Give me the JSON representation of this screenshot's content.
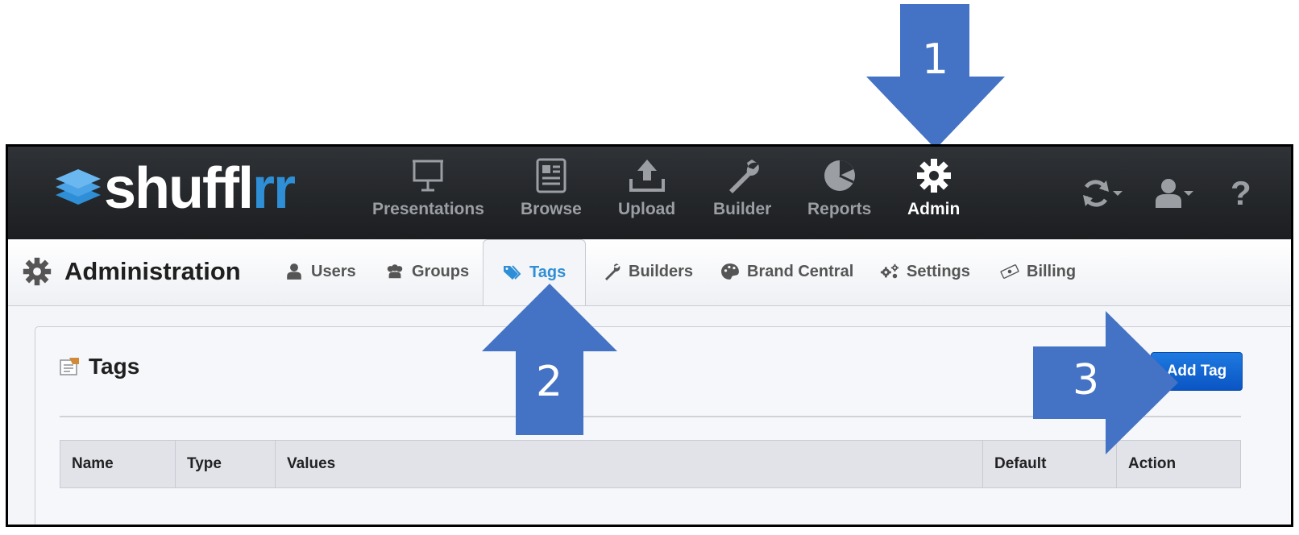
{
  "brand": {
    "logo_main": "shuffl",
    "logo_accent": "rr"
  },
  "topnav": {
    "items": [
      {
        "label": "Presentations",
        "icon": "presentation-board-icon"
      },
      {
        "label": "Browse",
        "icon": "browse-document-icon"
      },
      {
        "label": "Upload",
        "icon": "upload-icon"
      },
      {
        "label": "Builder",
        "icon": "wrench-icon"
      },
      {
        "label": "Reports",
        "icon": "pie-chart-icon"
      },
      {
        "label": "Admin",
        "icon": "gear-icon",
        "active": true
      }
    ],
    "right_icons": [
      "sync-icon",
      "user-icon",
      "help-icon"
    ],
    "help_glyph": "?"
  },
  "admin": {
    "title": "Administration",
    "tabs": [
      {
        "label": "Users",
        "icon": "user-icon"
      },
      {
        "label": "Groups",
        "icon": "groups-icon"
      },
      {
        "label": "Tags",
        "icon": "tag-icon",
        "active": true
      },
      {
        "label": "Builders",
        "icon": "wrench-icon"
      },
      {
        "label": "Brand Central",
        "icon": "palette-icon"
      },
      {
        "label": "Settings",
        "icon": "gears-icon"
      },
      {
        "label": "Billing",
        "icon": "money-icon"
      }
    ]
  },
  "tags_panel": {
    "title": "Tags",
    "add_button": "Add Tag",
    "columns": [
      "Name",
      "Type",
      "Values",
      "Default",
      "Action"
    ]
  },
  "callouts": [
    "1",
    "2",
    "3"
  ],
  "colors": {
    "callout": "#4472c4",
    "accent": "#2f8fd6",
    "topbar": "#26292c",
    "button": "#0f62d0"
  }
}
